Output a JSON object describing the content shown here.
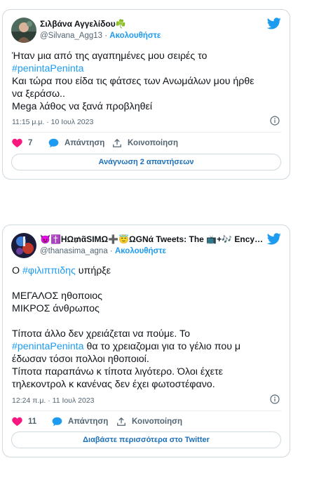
{
  "tweets": [
    {
      "author_name": "Σιλβάνα Αγγελίδου☘️",
      "handle": "@Silvana_Agg13",
      "separator": " · ",
      "follow_label": "Ακολουθήστε",
      "text_plain_1": "Ήταν μια από της αγαπημένες μου σειρές το",
      "hashtag_1": "#penintaPeninta",
      "text_plain_2": "Και τώρα που είδα τις φάτσες των Ανωμάλων μου ήρθε",
      "text_plain_3": "να ξεράσω..",
      "text_plain_4": "Mega λάθος να ξανά προβληθεί",
      "timestamp": "11:15 μ.μ. · 10 Ιουλ 2023",
      "like_count": "7",
      "reply_label": "Απάντηση",
      "share_label": "Κοινοποίηση",
      "read_more_label": "Ανάγνωση 2 απαντήσεων"
    },
    {
      "author_name": "😈✝️HΩ₥ᾶSIMΩ➕😇ΩGΝά Tweets: The 📺+🎶 Encyclo...",
      "handle": "@thanasima_agna",
      "separator": " · ",
      "follow_label": "Ακολουθήστε",
      "line_1_prefix": "Ο ",
      "hashtag_1": "#φιλιππιδης",
      "line_1_suffix": " υπήρξε",
      "line_2": "ΜΕΓΑΛΟΣ ηθοποιος",
      "line_3": "ΜΙΚΡΟΣ άνθρωπος",
      "line_4": "Τίποτα άλλο δεν χρειάζεται να πούμε. Το",
      "hashtag_2": "#penintaPeninta",
      "line_5_suffix": " θα το χρειαζομαι για το γέλιο που μ",
      "line_6": "έδωσαν τόσοι πολλοι ηθοποιοί.",
      "line_7": "Τίποτα παραπάνω κ τίποτα λιγότερο. Όλοι έχετε",
      "line_8": "τηλεκοντρολ κ κανένας δεν έχει φωτοστέφανο.",
      "timestamp": "12:24 π.μ. · 11 Ιουλ 2023",
      "like_count": "11",
      "reply_label": "Απάντηση",
      "share_label": "Κοινοποίηση",
      "read_more_label": "Διαβάστε περισσότερα στο Twitter"
    }
  ],
  "colors": {
    "accent": "#1d9bf0",
    "like": "#f91880",
    "muted": "#536471",
    "border": "#cfd9de"
  }
}
